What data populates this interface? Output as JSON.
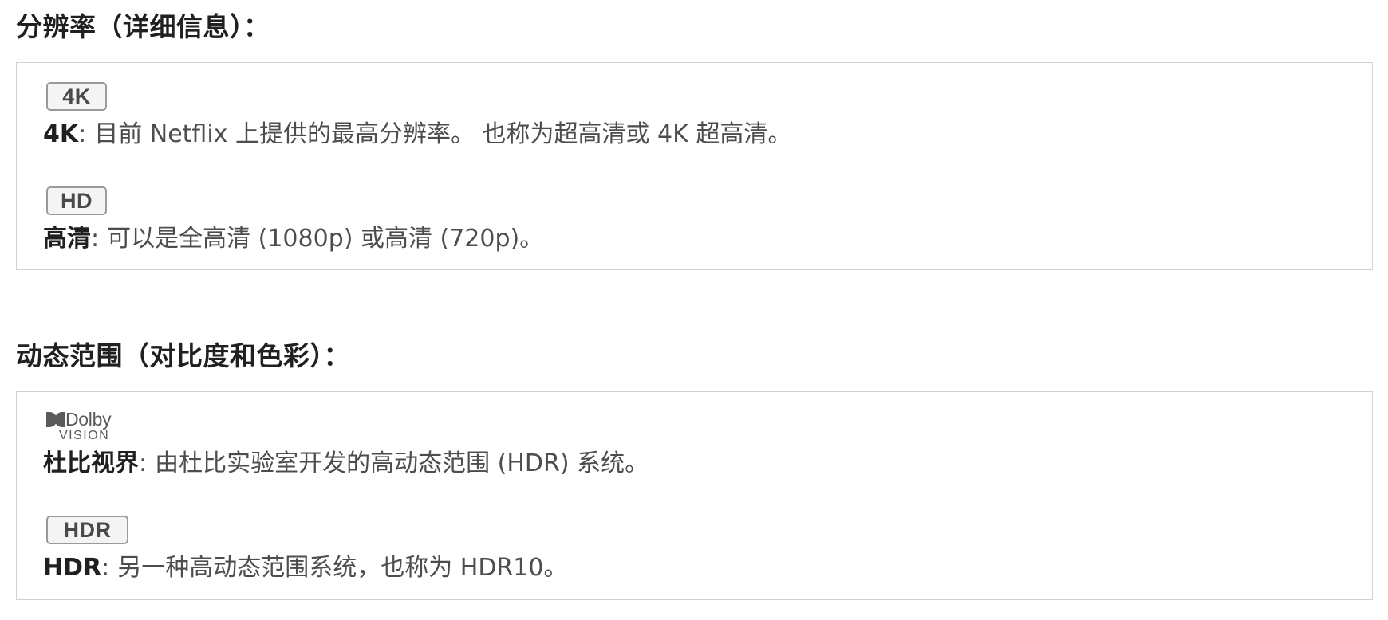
{
  "sections": [
    {
      "title": "分辨率（详细信息）：",
      "rows": [
        {
          "badge": "4K",
          "term": "4K",
          "colon": ":",
          "description": "目前 Netflix 上提供的最高分辨率。 也称为超高清或 4K 超高清。"
        },
        {
          "badge": "HD",
          "term": "高清",
          "colon": ":",
          "description": "可以是全高清 (1080p) 或高清 (720p)。"
        }
      ]
    },
    {
      "title": "动态范围（对比度和色彩）：",
      "rows": [
        {
          "logo": {
            "word": "Dolby",
            "subword": "VISION",
            "icon": "dolby-double-d-icon"
          },
          "term": "杜比视界",
          "colon": ":",
          "description": "由杜比实验室开发的高动态范围 (HDR) 系统。"
        },
        {
          "badge": "HDR",
          "term": "HDR",
          "colon": ":",
          "description": "另一种高动态范围系统，也称为 HDR10。"
        }
      ]
    }
  ],
  "colors": {
    "heading": "#221f1f",
    "body_text": "#4d4d4d",
    "border": "#d2d2d2",
    "badge_border": "#9a9a9a",
    "badge_text": "#4a4a4a"
  }
}
